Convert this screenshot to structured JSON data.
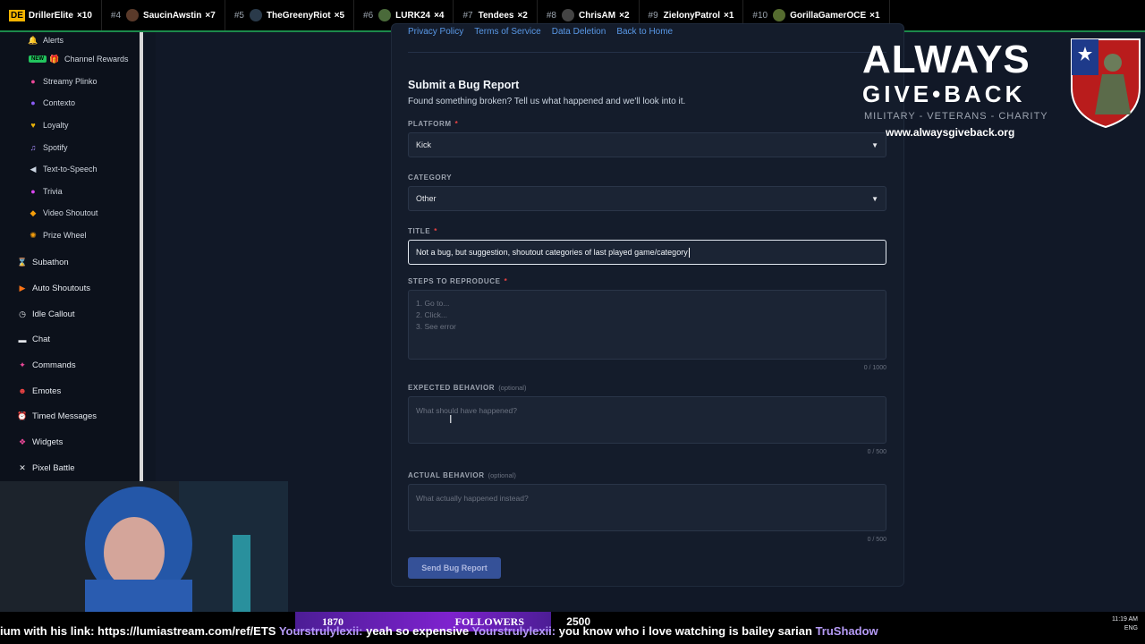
{
  "leaderboard": [
    {
      "rank": "DE",
      "name": "DrillerElite",
      "count": "×10"
    },
    {
      "rank": "#4",
      "name": "SaucinAwstin",
      "count": "×7"
    },
    {
      "rank": "#5",
      "name": "TheGreenyRiot",
      "count": "×5"
    },
    {
      "rank": "#6",
      "name": "LURK24",
      "count": "×4"
    },
    {
      "rank": "#7",
      "name": "Tendees",
      "count": "×2"
    },
    {
      "rank": "#8",
      "name": "ChrisAM",
      "count": "×2"
    },
    {
      "rank": "#9",
      "name": "ZielonyPatrol",
      "count": "×1"
    },
    {
      "rank": "#10",
      "name": "GorillaGamerOCE",
      "count": "×1"
    }
  ],
  "sidebar": {
    "sub_items": [
      {
        "label": "Alerts",
        "icon": "bell-icon"
      },
      {
        "label": "Channel Rewards",
        "icon": "gift-icon",
        "badge": "NEW"
      },
      {
        "label": "Streamy Plinko",
        "icon": "plinko-icon"
      },
      {
        "label": "Contexto",
        "icon": "contexto-icon"
      },
      {
        "label": "Loyalty",
        "icon": "loyalty-icon"
      },
      {
        "label": "Spotify",
        "icon": "music-icon"
      },
      {
        "label": "Text-to-Speech",
        "icon": "speaker-icon"
      },
      {
        "label": "Trivia",
        "icon": "trivia-icon"
      },
      {
        "label": "Video Shoutout",
        "icon": "video-icon"
      },
      {
        "label": "Prize Wheel",
        "icon": "wheel-icon"
      }
    ],
    "top_items": [
      {
        "label": "Subathon",
        "icon": "hourglass-icon"
      },
      {
        "label": "Auto Shoutouts",
        "icon": "megaphone-icon"
      },
      {
        "label": "Idle Callout",
        "icon": "clock-icon"
      },
      {
        "label": "Chat",
        "icon": "chat-icon"
      },
      {
        "label": "Commands",
        "icon": "command-icon"
      },
      {
        "label": "Emotes",
        "icon": "emote-icon"
      },
      {
        "label": "Timed Messages",
        "icon": "timer-icon"
      },
      {
        "label": "Widgets",
        "icon": "widgets-icon"
      },
      {
        "label": "Pixel Battle",
        "icon": "swords-icon"
      }
    ]
  },
  "links": {
    "privacy": "Privacy Policy",
    "terms": "Terms of Service",
    "data": "Data Deletion",
    "home": "Back to Home"
  },
  "form": {
    "title": "Submit a Bug Report",
    "subtitle": "Found something broken? Tell us what happened and we'll look into it.",
    "platform_label": "PLATFORM",
    "platform_value": "Kick",
    "category_label": "CATEGORY",
    "category_value": "Other",
    "title_label": "TITLE",
    "title_value": "Not a bug, but suggestion, shoutout categories of last played game/category",
    "steps_label": "STEPS TO REPRODUCE",
    "steps_placeholder_1": "1. Go to...",
    "steps_placeholder_2": "2. Click...",
    "steps_placeholder_3": "3. See error",
    "steps_counter": "0 / 1000",
    "expected_label": "EXPECTED BEHAVIOR",
    "expected_optional": "(optional)",
    "expected_placeholder": "What should have happened?",
    "expected_counter": "0 / 500",
    "actual_label": "ACTUAL BEHAVIOR",
    "actual_optional": "(optional)",
    "actual_placeholder": "What actually happened instead?",
    "actual_counter": "0 / 500",
    "submit": "Send Bug Report",
    "required_mark": "*"
  },
  "promo": {
    "line1": "ALWAYS",
    "line2": "GIVE•BACK",
    "tagline": "MILITARY - VETERANS - CHARITY",
    "url": "www.alwaysgiveback.org"
  },
  "ticker": {
    "text_1": "ium with his link: https://lumiastream.com/ref/ETS",
    "user_1": "Yourstrulylexii:",
    "msg_1": "yeah so expensive",
    "user_2": "Yourstrulylexii:",
    "msg_2": "you know who i love watching is bailey sarian",
    "user_3": "TruShadow"
  },
  "followers": {
    "current": "1870",
    "label": "FOLLOWERS",
    "goal": "2500"
  },
  "clock": {
    "time": "11:19 AM",
    "lang": "ENG"
  }
}
